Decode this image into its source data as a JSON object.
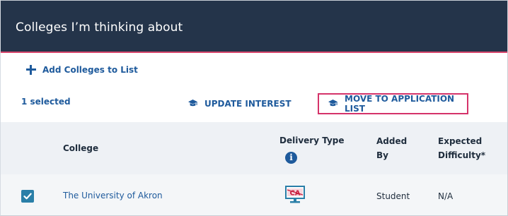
{
  "panel": {
    "title": "Colleges I’m thinking about"
  },
  "toolbar": {
    "add_label": "Add Colleges to List",
    "selected_text": "1 selected",
    "update_interest_label": "UPDATE INTEREST",
    "move_label": "MOVE TO APPLICATION LIST"
  },
  "table": {
    "headers": {
      "college": "College",
      "delivery_type": "Delivery Type",
      "added_by_line1": "Added",
      "added_by_line2": "By",
      "difficulty_line1": "Expected",
      "difficulty_line2": "Difficulty*"
    },
    "rows": [
      {
        "selected": true,
        "college": "The University of Akron",
        "delivery_icon": "common-app-icon",
        "delivery_icon_text": "CA",
        "added_by": "Student",
        "expected_difficulty": "N/A"
      }
    ]
  },
  "colors": {
    "title_bar": "#24344a",
    "accent_pink": "#d5336a",
    "link_blue": "#1e5a9c",
    "checkbox_teal": "#2a7fa8"
  }
}
